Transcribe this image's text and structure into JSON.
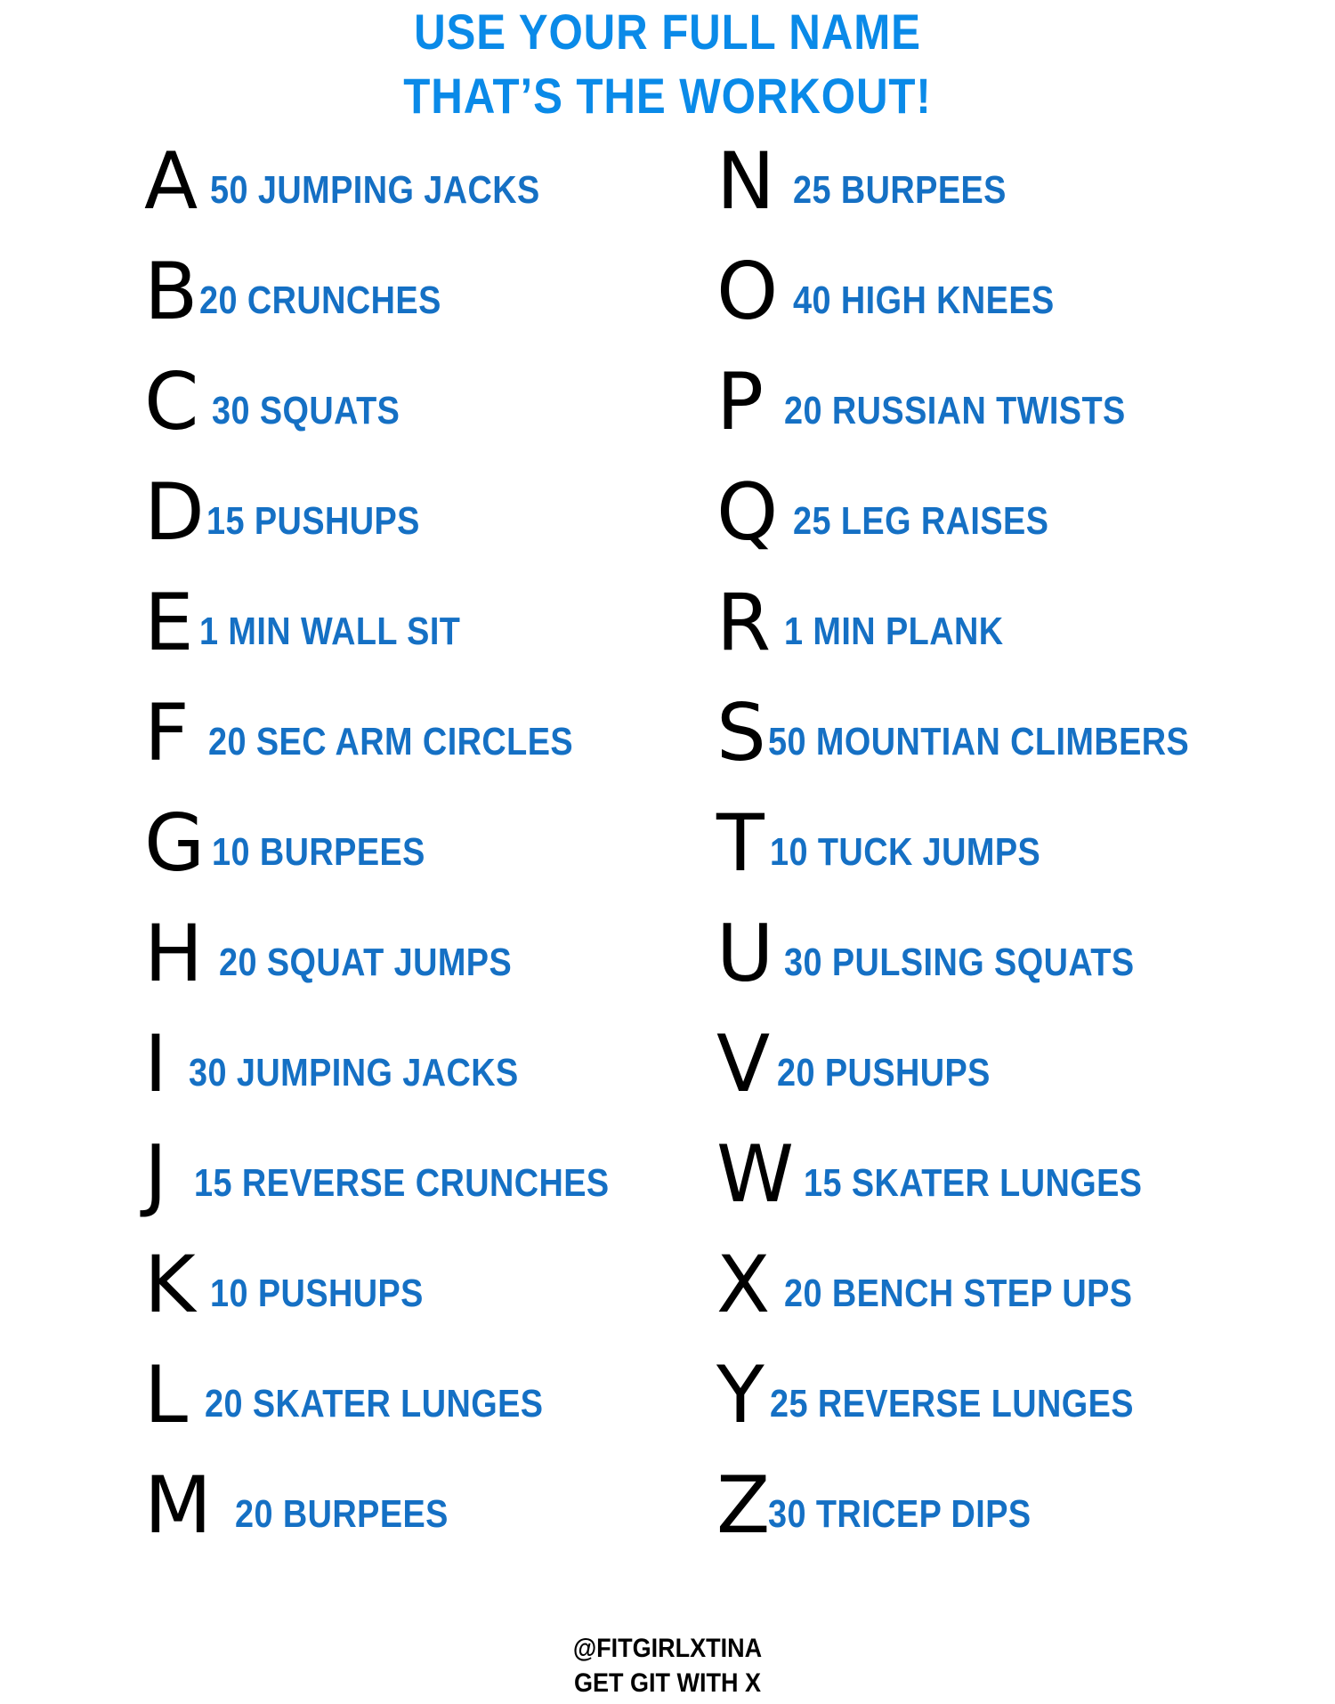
{
  "header": {
    "title_line1": "USE YOUR FULL NAME",
    "title_line2": "THAT’S THE WORKOUT!"
  },
  "colors": {
    "title": "#0a8ae8",
    "exercise_text": "#1570c4",
    "letter_text": "#000000"
  },
  "left_column": [
    {
      "letter": "A",
      "exercise": "50 JUMPING JACKS"
    },
    {
      "letter": "B",
      "exercise": "20 CRUNCHES"
    },
    {
      "letter": "C",
      "exercise": "30 SQUATS"
    },
    {
      "letter": "D",
      "exercise": "15 PUSHUPS"
    },
    {
      "letter": "E",
      "exercise": "1 MIN WALL SIT"
    },
    {
      "letter": "F",
      "exercise": "20 SEC ARM CIRCLES"
    },
    {
      "letter": "G",
      "exercise": "10 BURPEES"
    },
    {
      "letter": "H",
      "exercise": "20 SQUAT JUMPS"
    },
    {
      "letter": "I",
      "exercise": "30 JUMPING JACKS"
    },
    {
      "letter": "J",
      "exercise": "15 REVERSE CRUNCHES"
    },
    {
      "letter": "K",
      "exercise": "10 PUSHUPS"
    },
    {
      "letter": "L",
      "exercise": "20 SKATER LUNGES"
    },
    {
      "letter": "M",
      "exercise": "20 BURPEES"
    }
  ],
  "right_column": [
    {
      "letter": "N",
      "exercise": "25 BURPEES"
    },
    {
      "letter": "O",
      "exercise": "40 HIGH KNEES"
    },
    {
      "letter": "P",
      "exercise": "20 RUSSIAN TWISTS"
    },
    {
      "letter": "Q",
      "exercise": "25 LEG RAISES"
    },
    {
      "letter": "R",
      "exercise": "1 MIN PLANK"
    },
    {
      "letter": "S",
      "exercise": "50 MOUNTIAN CLIMBERS"
    },
    {
      "letter": "T",
      "exercise": "10 TUCK JUMPS"
    },
    {
      "letter": "U",
      "exercise": "30 PULSING SQUATS"
    },
    {
      "letter": "V",
      "exercise": "20 PUSHUPS"
    },
    {
      "letter": "W",
      "exercise": "15 SKATER LUNGES"
    },
    {
      "letter": "X",
      "exercise": "20 BENCH STEP UPS"
    },
    {
      "letter": "Y",
      "exercise": "25 REVERSE LUNGES"
    },
    {
      "letter": "Z",
      "exercise": "30 TRICEP DIPS"
    }
  ],
  "footer": {
    "handle": "@FITGIRLXTINA",
    "tagline": "GET GIT WITH X"
  }
}
